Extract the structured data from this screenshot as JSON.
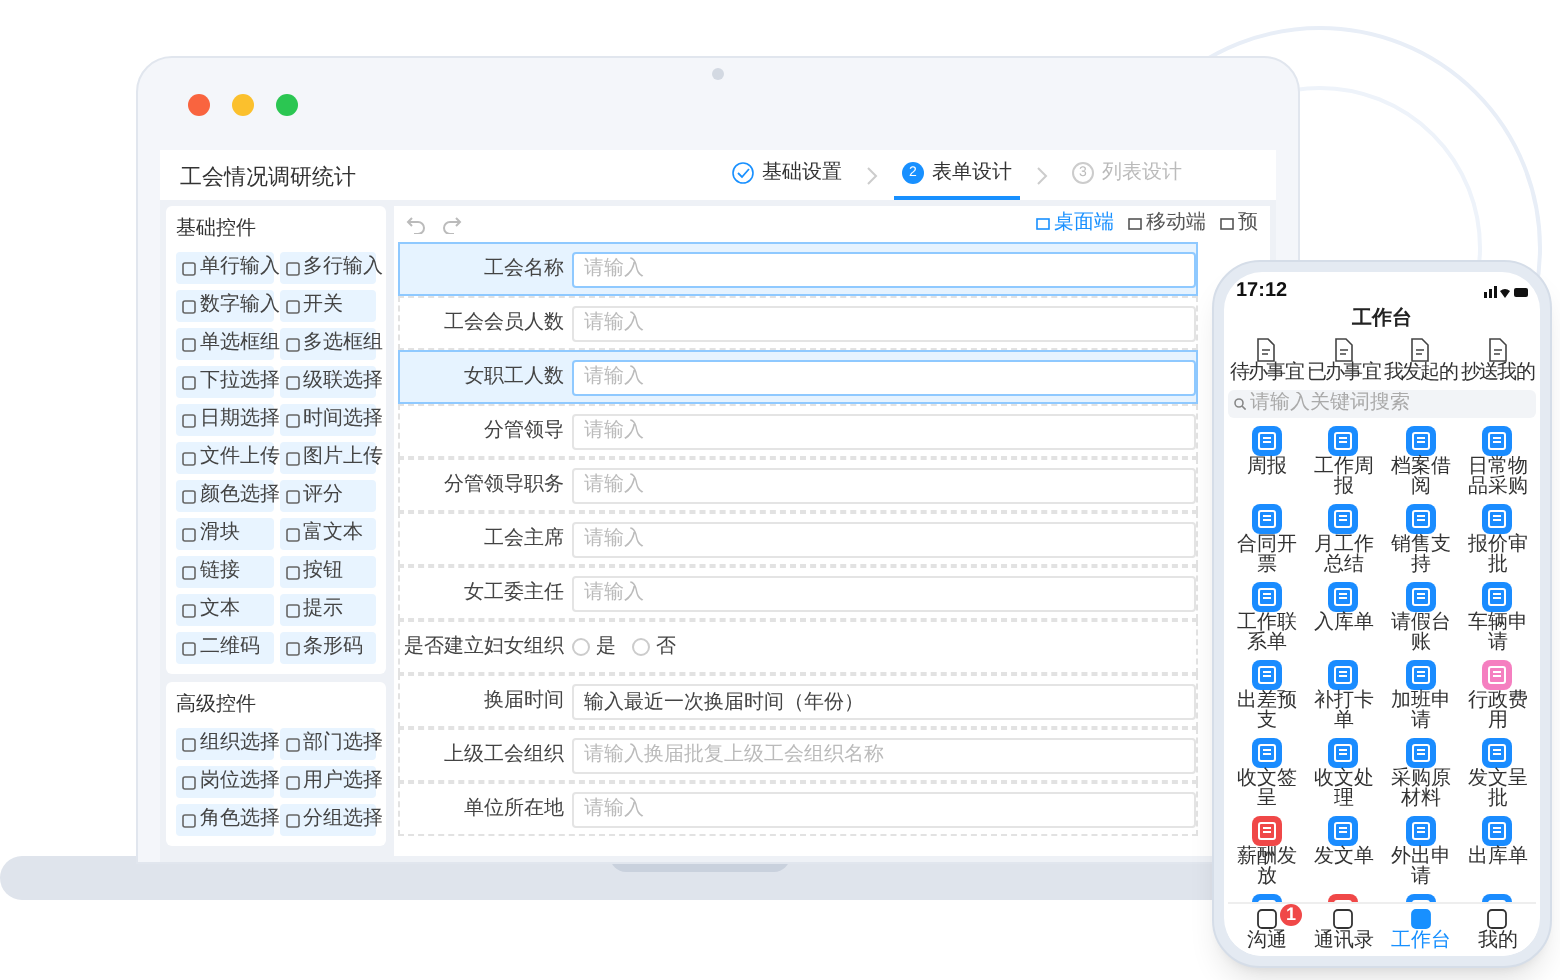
{
  "window": {
    "title": "工会情况调研统计"
  },
  "steps": [
    {
      "label": "基础设置",
      "done": true,
      "selected": false
    },
    {
      "number": "2",
      "label": "表单设计",
      "done": false,
      "selected": true
    },
    {
      "number": "3",
      "label": "列表设计",
      "done": false,
      "selected": false
    }
  ],
  "palette": [
    {
      "title": "基础控件",
      "items": [
        "单行输入",
        "多行输入",
        "数字输入",
        "开关",
        "单选框组",
        "多选框组",
        "下拉选择",
        "级联选择",
        "日期选择",
        "时间选择",
        "文件上传",
        "图片上传",
        "颜色选择",
        "评分",
        "滑块",
        "富文本",
        "链接",
        "按钮",
        "文本",
        "提示",
        "二维码",
        "条形码"
      ]
    },
    {
      "title": "高级控件",
      "items": [
        "组织选择",
        "部门选择",
        "岗位选择",
        "用户选择",
        "角色选择",
        "分组选择"
      ]
    }
  ],
  "view_tabs": [
    {
      "label": "桌面端",
      "selected": true
    },
    {
      "label": "移动端",
      "selected": false
    },
    {
      "label": "预",
      "selected": false
    }
  ],
  "form_fields": [
    {
      "label": "工会名称",
      "kind": "input",
      "placeholder": "请输入",
      "selected": true
    },
    {
      "label": "工会会员人数",
      "kind": "input",
      "placeholder": "请输入",
      "selected": false
    },
    {
      "label": "女职工人数",
      "kind": "input",
      "placeholder": "请输入",
      "selected": true
    },
    {
      "label": "分管领导",
      "kind": "input",
      "placeholder": "请输入",
      "selected": false
    },
    {
      "label": "分管领导职务",
      "kind": "input",
      "placeholder": "请输入",
      "selected": false
    },
    {
      "label": "工会主席",
      "kind": "input",
      "placeholder": "请输入",
      "selected": false
    },
    {
      "label": "女工委主任",
      "kind": "input",
      "placeholder": "请输入",
      "selected": false
    },
    {
      "label": "是否建立妇女组织",
      "kind": "radio",
      "selected": false,
      "options": [
        {
          "label": "是",
          "selected": false
        },
        {
          "label": "否",
          "selected": false
        }
      ]
    },
    {
      "label": "换届时间",
      "kind": "input",
      "value": "输入最近一次换届时间（年份）",
      "selected": false
    },
    {
      "label": "上级工会组织",
      "kind": "input",
      "placeholder": "请输入换届批复上级工会组织名称",
      "selected": false
    },
    {
      "label": "单位所在地",
      "kind": "input",
      "placeholder": "请输入",
      "selected": false
    }
  ],
  "phone": {
    "time": "17:12",
    "title": "工作台",
    "shortcuts": [
      "待办事宜",
      "已办事宜",
      "我发起的",
      "抄送我的"
    ],
    "search": {
      "placeholder": "请输入关键词搜索"
    },
    "apps": [
      {
        "label": "周报",
        "color": "#1a8cff"
      },
      {
        "label": "工作周报",
        "color": "#1a8cff"
      },
      {
        "label": "档案借阅",
        "color": "#1a8cff"
      },
      {
        "label": "日常物品采购",
        "color": "#1a8cff"
      },
      {
        "label": "合同开票",
        "color": "#1a8cff"
      },
      {
        "label": "月工作总结",
        "color": "#1a8cff"
      },
      {
        "label": "销售支持",
        "color": "#1a8cff"
      },
      {
        "label": "报价审批",
        "color": "#1a8cff"
      },
      {
        "label": "工作联系单",
        "color": "#1a8cff"
      },
      {
        "label": "入库单",
        "color": "#1a8cff"
      },
      {
        "label": "请假台账",
        "color": "#1a8cff"
      },
      {
        "label": "车辆申请",
        "color": "#1a8cff"
      },
      {
        "label": "出差预支",
        "color": "#1a8cff"
      },
      {
        "label": "补打卡单",
        "color": "#1a8cff"
      },
      {
        "label": "加班申请",
        "color": "#1a8cff"
      },
      {
        "label": "行政费用",
        "color": "#f57fc0"
      },
      {
        "label": "收文签呈",
        "color": "#1a8cff"
      },
      {
        "label": "收文处理",
        "color": "#1a8cff"
      },
      {
        "label": "采购原材料",
        "color": "#1a8cff"
      },
      {
        "label": "发文呈批",
        "color": "#1a8cff"
      },
      {
        "label": "薪酬发放",
        "color": "#f04848"
      },
      {
        "label": "发文单",
        "color": "#1a8cff"
      },
      {
        "label": "外出申请",
        "color": "#1a8cff"
      },
      {
        "label": "出库单",
        "color": "#1a8cff"
      },
      {
        "color": "#1a8cff"
      },
      {
        "color": "#f04848"
      },
      {
        "color": "#1a8cff"
      },
      {
        "color": "#1a8cff"
      }
    ],
    "tabs": [
      {
        "label": "沟通",
        "selected": false,
        "badge": "1"
      },
      {
        "label": "通讯录",
        "selected": false
      },
      {
        "label": "工作台",
        "selected": true
      },
      {
        "label": "我的",
        "selected": false
      }
    ]
  }
}
